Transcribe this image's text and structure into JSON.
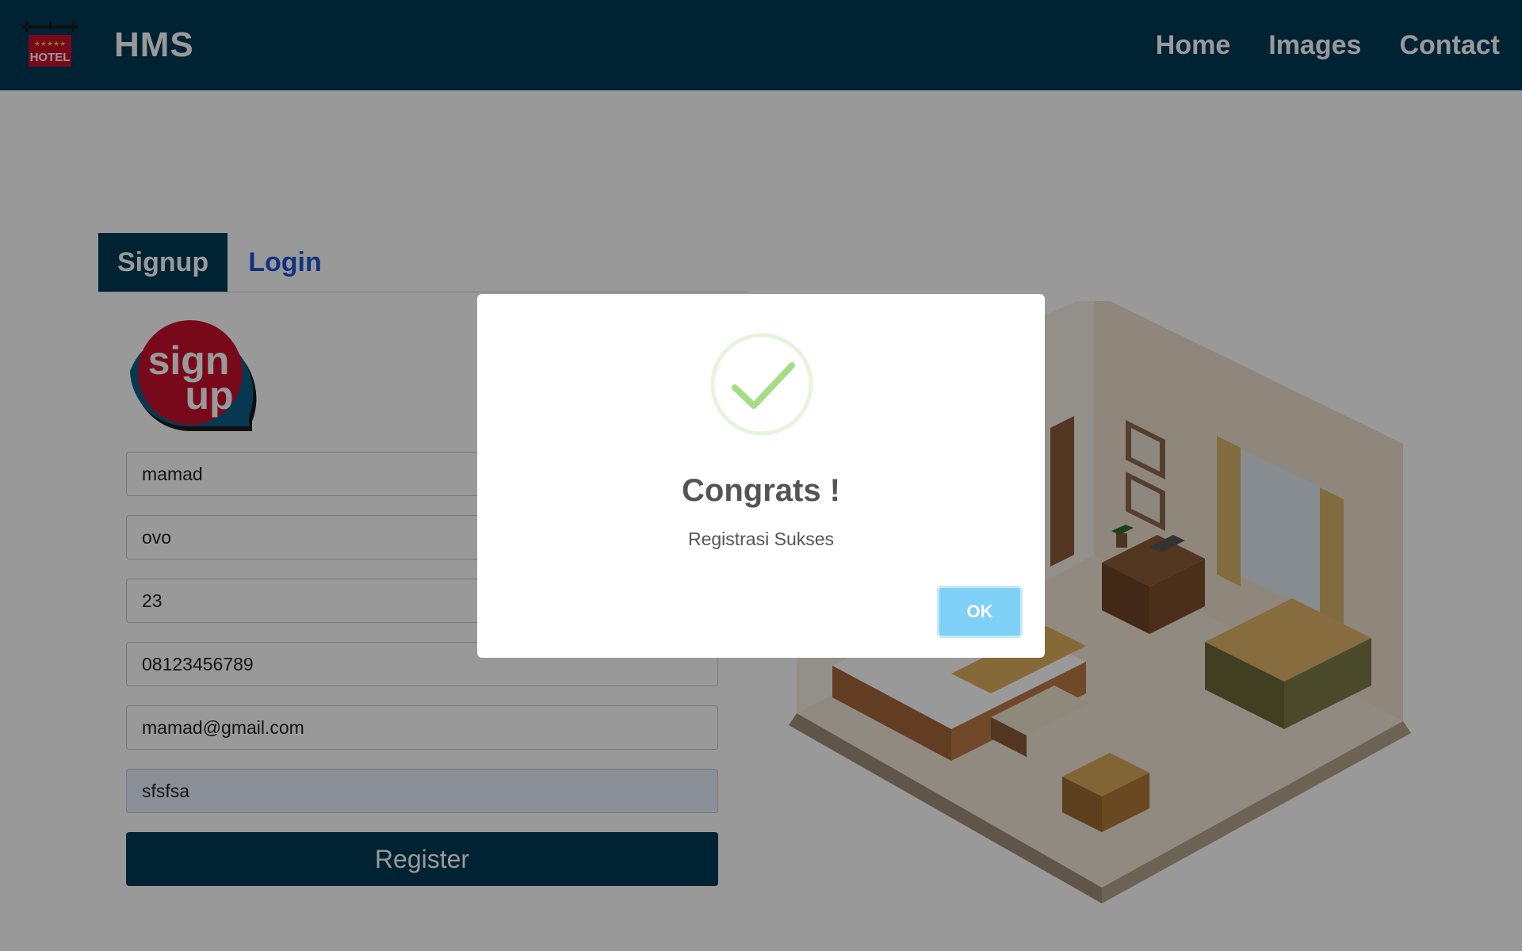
{
  "navbar": {
    "logo_text": "HOTEL",
    "brand": "HMS",
    "links": [
      "Home",
      "Images",
      "Contact"
    ],
    "background_color": "#003b57"
  },
  "tabs": [
    {
      "label": "Signup",
      "active": true
    },
    {
      "label": "Login",
      "active": false
    }
  ],
  "signup_badge_text": [
    "sign",
    "up"
  ],
  "form": {
    "fields": [
      {
        "name": "first-name",
        "value": "mamad"
      },
      {
        "name": "last-name",
        "value": "ovo"
      },
      {
        "name": "age",
        "value": "23"
      },
      {
        "name": "phone",
        "value": "08123456789"
      },
      {
        "name": "email",
        "value": "mamad@gmail.com"
      },
      {
        "name": "password",
        "value": "sfsfsa"
      }
    ],
    "register_label": "Register"
  },
  "modal": {
    "icon": "success-check-icon",
    "title": "Congrats !",
    "text": "Registrasi Sukses",
    "ok_label": "OK",
    "accent_color": "#7fd0f7",
    "check_color": "#a5dc86"
  }
}
